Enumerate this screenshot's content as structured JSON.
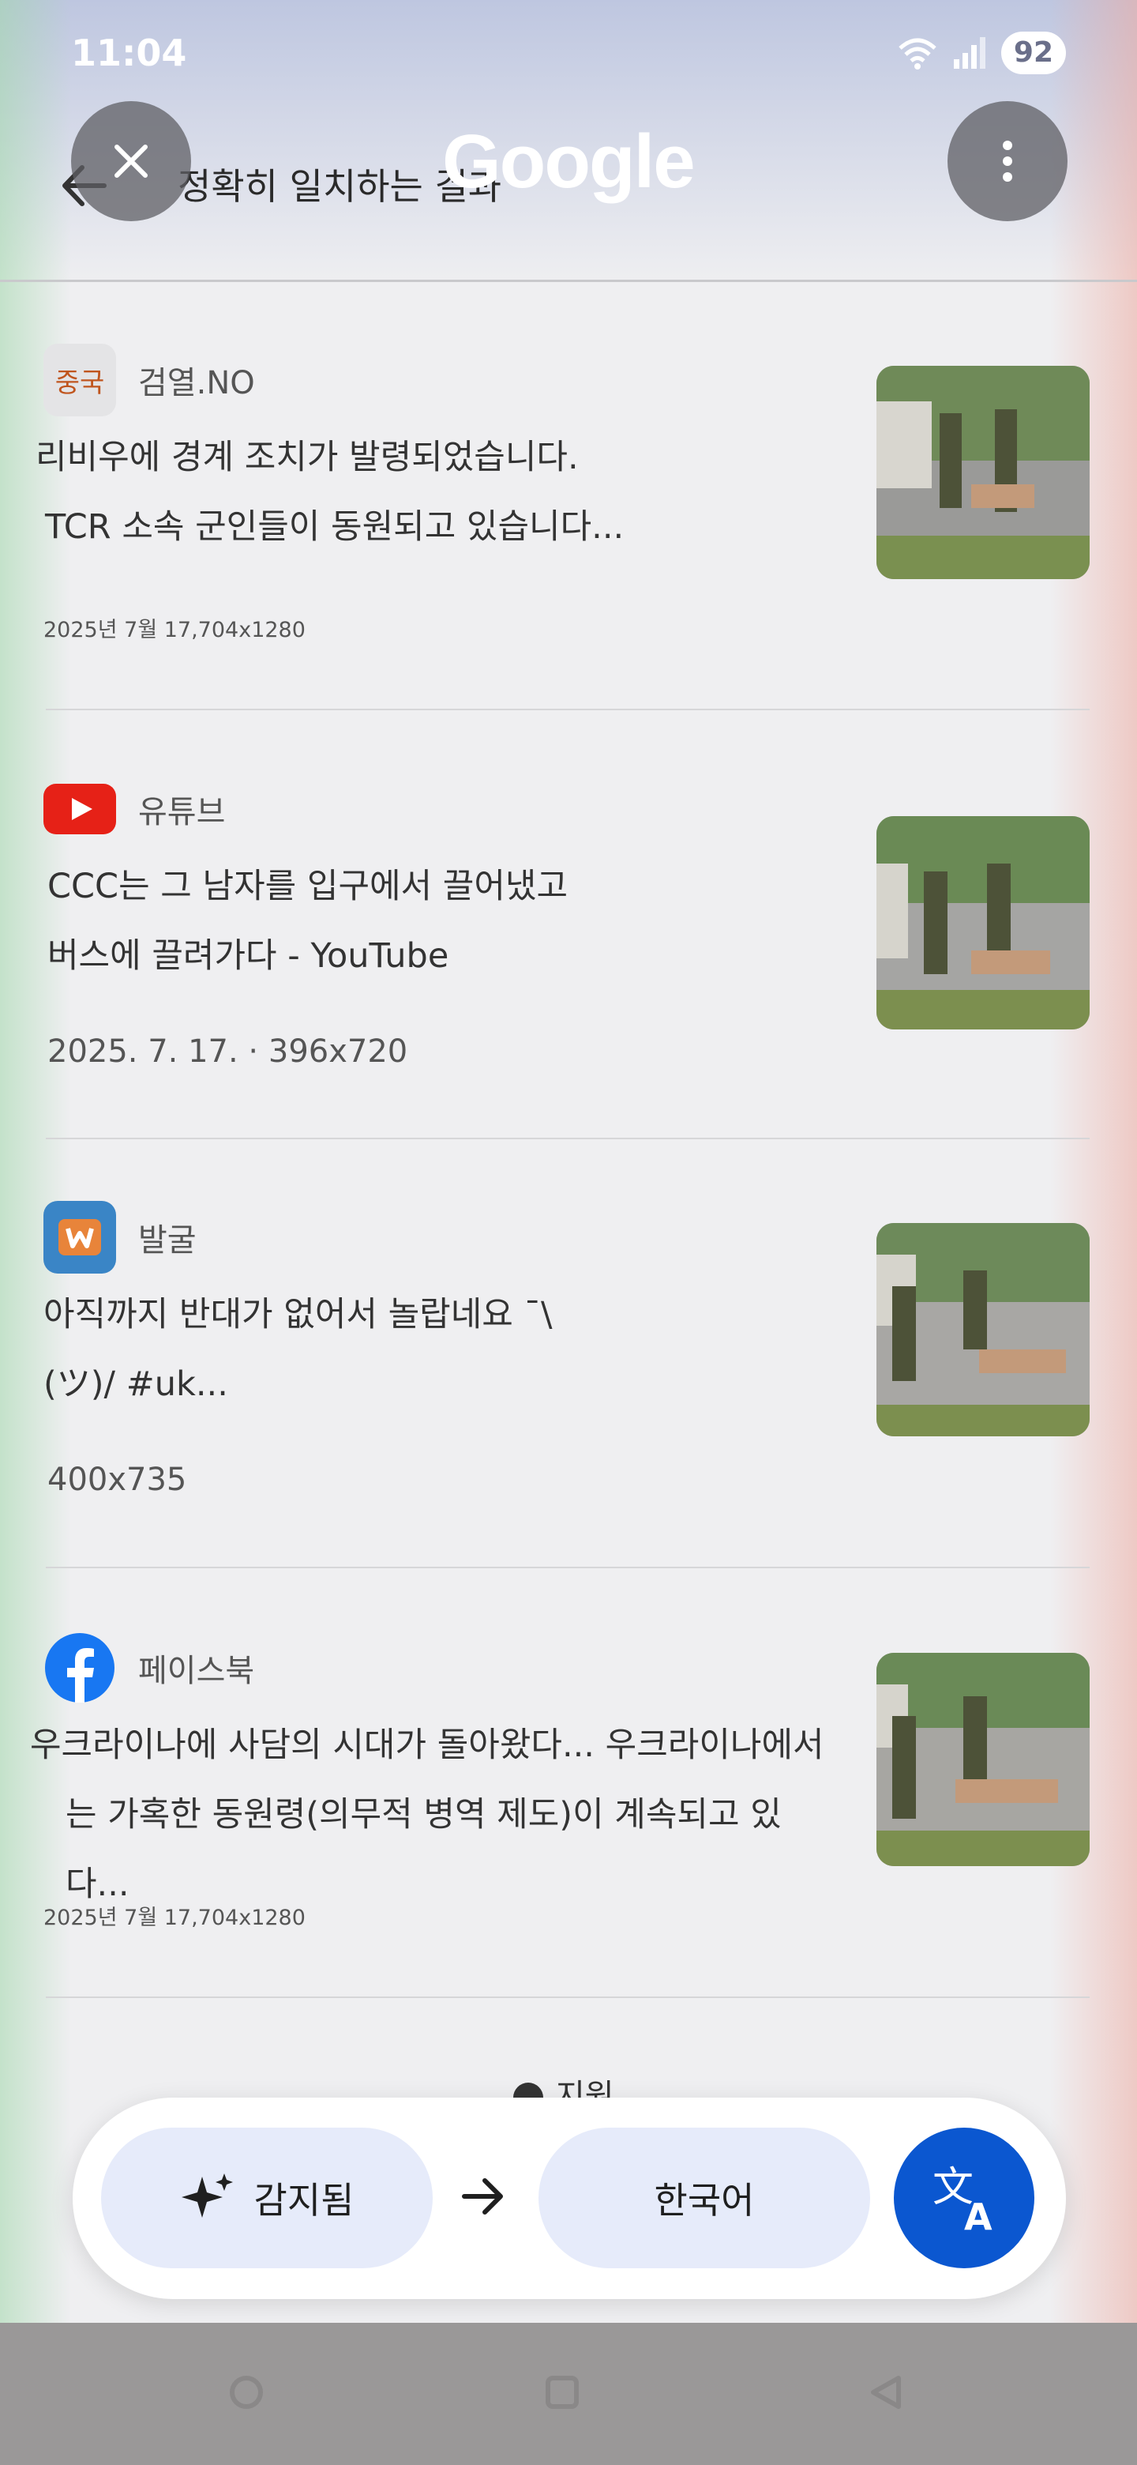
{
  "status": {
    "time": "11:04",
    "battery": "92"
  },
  "header": {
    "title": "정확히 일치하는 결과",
    "brand": "Google"
  },
  "results": [
    {
      "source": "검열.NO",
      "source_icon_text": "중국",
      "title_line1": "리비우에 경계 조치가 발령되었습니다.",
      "title_line2": "TCR 소속 군인들이 동원되고 있습니다...",
      "meta": "2025년 7월      17,704x1280"
    },
    {
      "source": "유튜브",
      "title_line1": "CCC는 그 남자를 입구에서 끌어냈고",
      "title_line2": "버스에 끌려가다 - YouTube",
      "meta": "2025. 7. 17. · 396x720"
    },
    {
      "source": "발굴",
      "title_line1": "아직까지 반대가 없어서 놀랍네요 ¯\\",
      "title_line2": "(ツ)/ #uk...",
      "meta": "400x735"
    },
    {
      "source": "페이스북",
      "title_line1": "우크라이나에 사담의 시대가 돌아왔다... 우크라이나에서",
      "title_line2": "는 가혹한 동원령(의무적 병역 제도)이 계속되고 있다...",
      "meta": "2025년 7월      17,704x1280"
    }
  ],
  "support_label": "지원",
  "translate": {
    "detected": "감지됨",
    "target": "한국어"
  },
  "colors": {
    "accent": "#0b57d0",
    "pill": "#e6ebfa",
    "youtube": "#e62117",
    "facebook": "#1877f2"
  }
}
